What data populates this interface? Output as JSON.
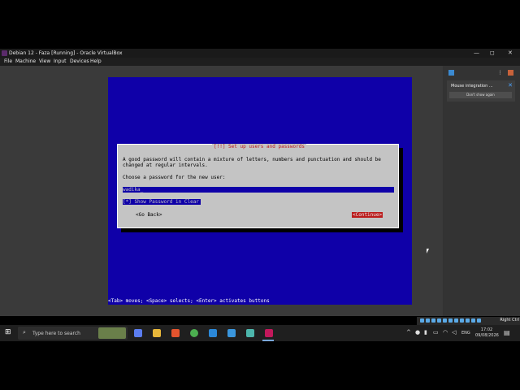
{
  "window": {
    "title": "Debian 12 - Faza [Running] - Oracle VirtualBox",
    "controls": {
      "minimize": "—",
      "maximize": "◻",
      "close": "✕"
    }
  },
  "menubar": {
    "items": [
      "File",
      "Machine",
      "View",
      "Input",
      "Devices",
      "Help"
    ]
  },
  "installer": {
    "dialog_title": "[!!] Set up users and passwords",
    "description_line1": "A good password will contain a mixture of letters, numbers and punctuation and should be",
    "description_line2": "changed at regular intervals.",
    "prompt": "Choose a password for the new user:",
    "password_value": "wadika_",
    "show_password": "[*] Show Password in Clear",
    "go_back": "<Go Back>",
    "continue": "<Continue>",
    "status_line": "<Tab> moves; <Space> selects; <Enter> activates buttons"
  },
  "notification": {
    "title": "Mouse integration ...",
    "close_icon": "✕",
    "button": "Don't show again"
  },
  "vbox_status": {
    "host_key": "Right Ctrl"
  },
  "taskbar": {
    "start_icon": "⊞",
    "search_icon": "⌕",
    "search_placeholder": "Type here to search",
    "tray_chevron": "^",
    "language": "ENG",
    "time": "17:02",
    "date": "09/08/2026",
    "notifications_icon": "▤"
  },
  "colors": {
    "installer_blue": "#0f00a8",
    "installer_gray": "#c4c4c4",
    "installer_red": "#bb1b1b"
  }
}
